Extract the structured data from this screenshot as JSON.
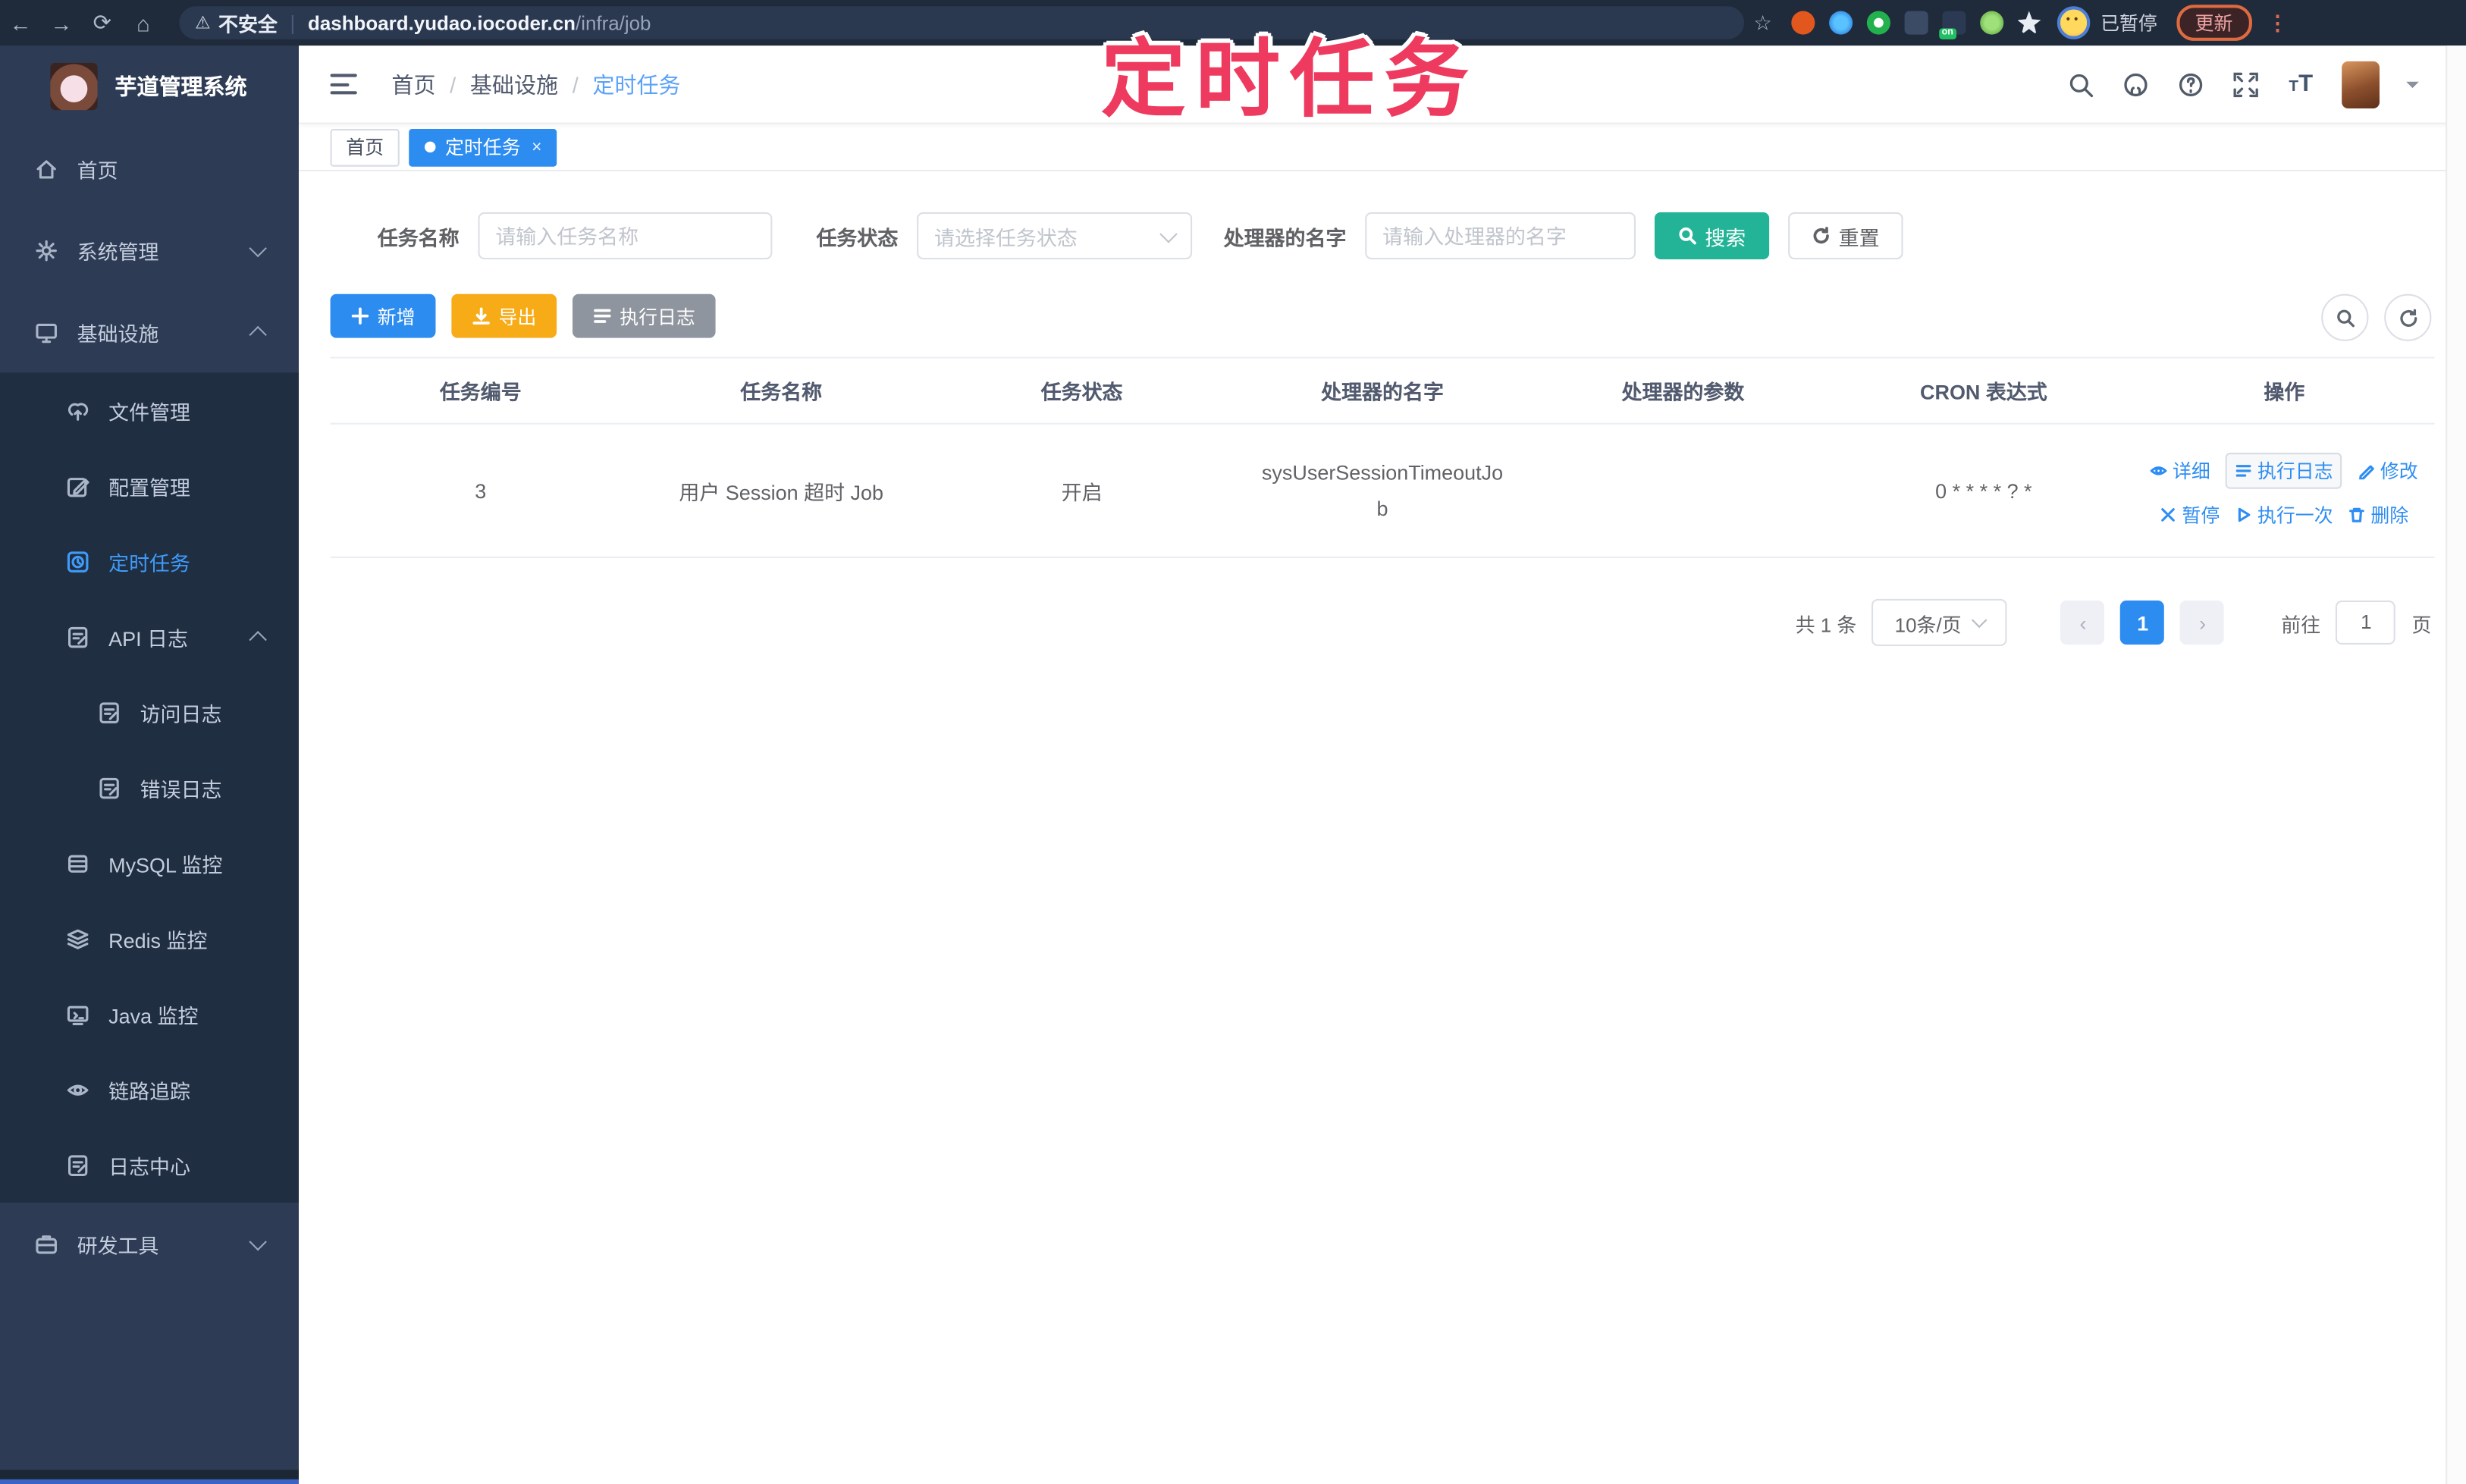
{
  "glyphs": {
    "back": "←",
    "forward": "→",
    "reload": "⟳",
    "home": "⌂",
    "warning": "⚠",
    "bookmark": "☆",
    "overflow": "⋮",
    "prev": "‹",
    "next": "›",
    "tab_close": "×",
    "help": "?",
    "font_size": "T",
    "breadcrumb_separator": "/"
  },
  "browser": {
    "security_label": "不安全",
    "url_host": "dashboard.yudao.iocoder.cn",
    "url_path": "/infra/job",
    "paused_badge": "已暂停",
    "update_button": "更新"
  },
  "annotation": {
    "text": "定时任务",
    "color": "#ee3a5f"
  },
  "sidebar": {
    "app_title": "芋道管理系统",
    "items": [
      {
        "label": "首页"
      },
      {
        "label": "系统管理"
      },
      {
        "label": "基础设施"
      },
      {
        "label": "文件管理"
      },
      {
        "label": "配置管理"
      },
      {
        "label": "定时任务"
      },
      {
        "label": "API 日志"
      },
      {
        "label": "访问日志"
      },
      {
        "label": "错误日志"
      },
      {
        "label": "MySQL 监控"
      },
      {
        "label": "Redis 监控"
      },
      {
        "label": "Java 监控"
      },
      {
        "label": "链路追踪"
      },
      {
        "label": "日志中心"
      },
      {
        "label": "研发工具"
      }
    ]
  },
  "navbar": {
    "breadcrumb": [
      "首页",
      "基础设施",
      "定时任务"
    ]
  },
  "tabs": [
    {
      "label": "首页"
    },
    {
      "label": "定时任务"
    }
  ],
  "filter": {
    "name_label": "任务名称",
    "name_placeholder": "请输入任务名称",
    "status_label": "任务状态",
    "status_placeholder": "请选择任务状态",
    "handler_label": "处理器的名字",
    "handler_placeholder": "请输入处理器的名字",
    "search_label": "搜索",
    "reset_label": "重置"
  },
  "toolbar": {
    "add_label": "新增",
    "export_label": "导出",
    "log_label": "执行日志"
  },
  "table": {
    "headers": [
      "任务编号",
      "任务名称",
      "任务状态",
      "处理器的名字",
      "处理器的参数",
      "CRON 表达式",
      "操作"
    ],
    "rows": [
      {
        "id": "3",
        "name": "用户 Session 超时 Job",
        "status": "开启",
        "handler": "sysUserSessionTimeoutJob",
        "param": "",
        "cron": "0 * * * * ? *"
      }
    ],
    "row_actions": [
      "详细",
      "执行日志",
      "修改",
      "暂停",
      "执行一次",
      "删除"
    ]
  },
  "pagination": {
    "total": "共 1 条",
    "page_size": "10条/页",
    "current": "1",
    "goto_label": "前往",
    "goto_value": "1",
    "page_suffix": "页"
  },
  "colors": {
    "accent_blue": "#2d8cf0",
    "search_teal": "#23b397",
    "export_orange": "#f7ab17",
    "annotation_red": "#ee3a5f"
  }
}
